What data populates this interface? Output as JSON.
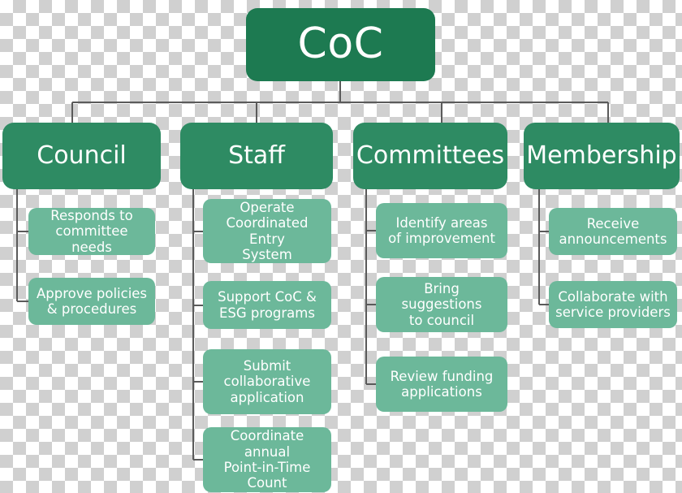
{
  "diagram": {
    "type": "organization-chart",
    "title": "CoC",
    "colors": {
      "root": "#1d7a51",
      "level1": "#2e8b63",
      "level2": "#6cb89a",
      "connector": "#5a5a5a",
      "text": "#ffffff"
    },
    "root": {
      "label": "CoC"
    },
    "branches": [
      {
        "label": "Council",
        "children": [
          {
            "label": "Responds to\ncommittee needs"
          },
          {
            "label": "Approve policies\n& procedures"
          }
        ]
      },
      {
        "label": "Staff",
        "children": [
          {
            "label": "Operate\nCoordinated Entry\nSystem"
          },
          {
            "label": "Support CoC &\nESG programs"
          },
          {
            "label": "Submit\ncollaborative\napplication"
          },
          {
            "label": "Coordinate annual\nPoint-in-Time\nCount"
          }
        ]
      },
      {
        "label": "Committees",
        "children": [
          {
            "label": "Identify areas\nof improvement"
          },
          {
            "label": "Bring suggestions\nto council"
          },
          {
            "label": "Review funding\napplications"
          }
        ]
      },
      {
        "label": "Membership",
        "children": [
          {
            "label": "Receive\nannouncements"
          },
          {
            "label": "Collaborate with\nservice providers"
          }
        ]
      }
    ]
  }
}
